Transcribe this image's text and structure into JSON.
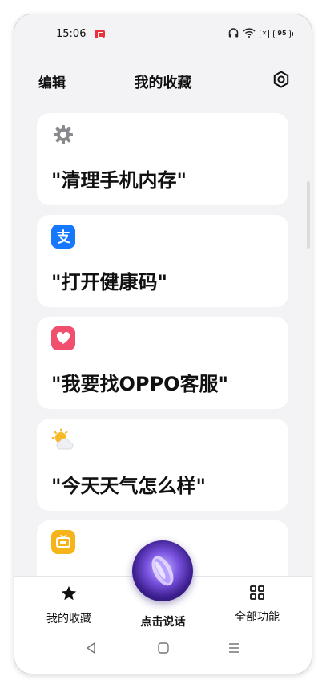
{
  "status_bar": {
    "time": "15:06",
    "battery": "95"
  },
  "header": {
    "edit_label": "编辑",
    "title": "我的收藏"
  },
  "cards": [
    {
      "text": "\"清理手机内存\"",
      "icon": "gear-icon"
    },
    {
      "text": "\"打开健康码\"",
      "icon": "alipay-icon"
    },
    {
      "text": "\"我要找OPPO客服\"",
      "icon": "heart-icon"
    },
    {
      "text": "\"今天天气怎么样\"",
      "icon": "weather-sun-cloud-icon"
    },
    {
      "text": "",
      "icon": "tv-icon"
    }
  ],
  "bottom_nav": {
    "favorites_label": "我的收藏",
    "speak_label": "点击说话",
    "all_features_label": "全部功能"
  },
  "colors": {
    "alipay": "#1677ff",
    "heart": "#f0506e",
    "weather_sun": "#f7b928",
    "tv": "#f5b51a",
    "background": "#f3f3f5"
  }
}
